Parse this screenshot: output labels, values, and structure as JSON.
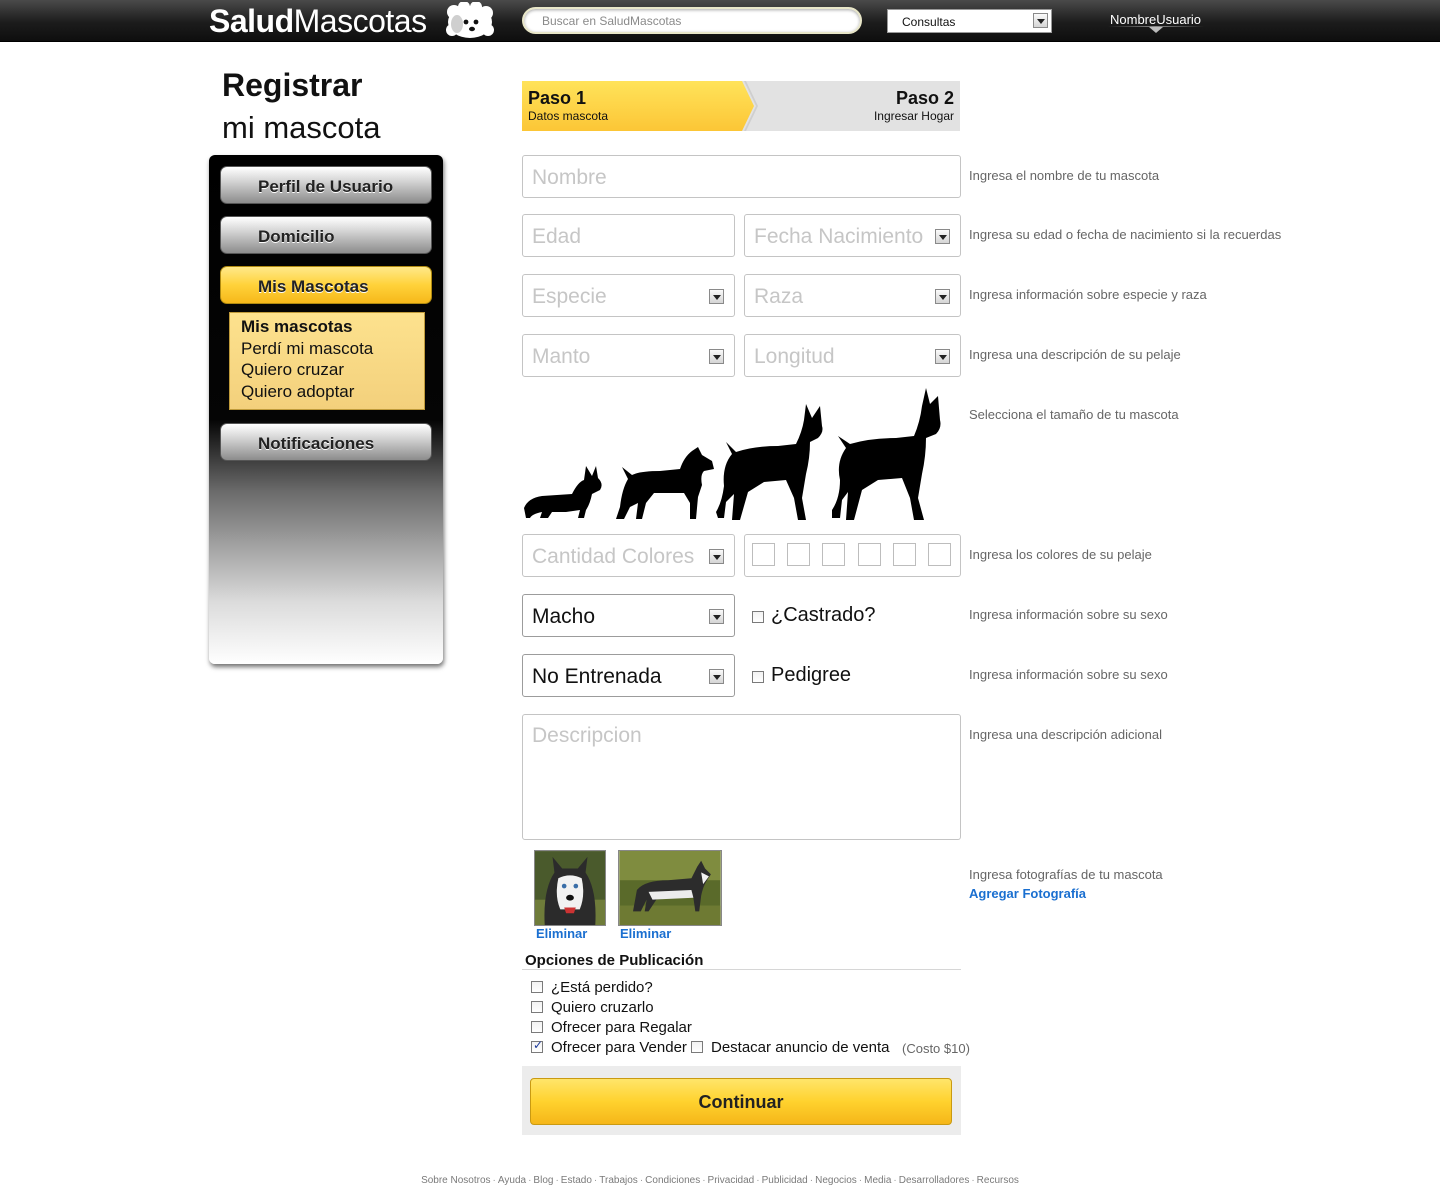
{
  "header": {
    "logo_bold": "Salud",
    "logo_light": "Mascotas",
    "search_placeholder": "Buscar en SaludMascotas",
    "consultas_selected": "Consultas",
    "username": "NombreUsuario"
  },
  "page": {
    "title_line1": "Registrar",
    "title_line2": "mi mascota"
  },
  "sidebar": {
    "items": [
      {
        "label": "Perfil de Usuario"
      },
      {
        "label": "Domicilio"
      },
      {
        "label": "Mis Mascotas"
      },
      {
        "label": "Notificaciones"
      }
    ],
    "submenu": [
      "Mis mascotas",
      "Perdí mi mascota",
      "Quiero cruzar",
      "Quiero adoptar"
    ]
  },
  "steps": {
    "step1_title": "Paso 1",
    "step1_sub": "Datos mascota",
    "step2_title": "Paso 2",
    "step2_sub": "Ingresar Hogar"
  },
  "form": {
    "nombre_placeholder": "Nombre",
    "edad_placeholder": "Edad",
    "fecha_placeholder": "Fecha Nacimiento",
    "especie_placeholder": "Especie",
    "raza_placeholder": "Raza",
    "manto_placeholder": "Manto",
    "longitud_placeholder": "Longitud",
    "cantidad_colores_placeholder": "Cantidad Colores",
    "sexo_value": "Macho",
    "castrado_label": "¿Castrado?",
    "entrenamiento_value": "No Entrenada",
    "pedigree_label": "Pedigree",
    "descripcion_placeholder": "Descripcion",
    "photo_delete_1": "Eliminar",
    "photo_delete_2": "Eliminar"
  },
  "hints": {
    "nombre": "Ingresa el nombre de tu mascota",
    "edad": "Ingresa su edad o fecha de nacimiento si la recuerdas",
    "especie": "Ingresa información sobre especie y raza",
    "pelaje_desc": "Ingresa una descripción de su pelaje",
    "tamano": "Selecciona el tamaño de tu mascota",
    "colores": "Ingresa los colores de su pelaje",
    "sexo1": "Ingresa información sobre su sexo",
    "sexo2": "Ingresa información sobre su sexo",
    "descripcion": "Ingresa una descripción adicional",
    "fotos": "Ingresa fotografías de tu mascota",
    "agregar_foto": "Agregar Fotografía"
  },
  "publicacion": {
    "title": "Opciones de Publicación",
    "options": [
      {
        "label": "¿Está perdido?",
        "checked": false
      },
      {
        "label": "Quiero cruzarlo",
        "checked": false
      },
      {
        "label": "Ofrecer para Regalar",
        "checked": false
      },
      {
        "label": "Ofrecer para Vender",
        "checked": true
      }
    ],
    "destacar_label": "Destacar anuncio de venta",
    "destacar_checked": false,
    "cost": "(Costo $10)"
  },
  "continue_label": "Continuar",
  "footer": [
    "Sobre Nosotros",
    "Ayuda",
    "Blog",
    "Estado",
    "Trabajos",
    "Condiciones",
    "Privacidad",
    "Publicidad",
    "Negocios",
    "Media",
    "Desarrolladores",
    "Recursos"
  ],
  "colors": {
    "accent_yellow": "#fcc636",
    "link_blue": "#1a6fd0",
    "topbar_dark": "#1c1c1c"
  }
}
